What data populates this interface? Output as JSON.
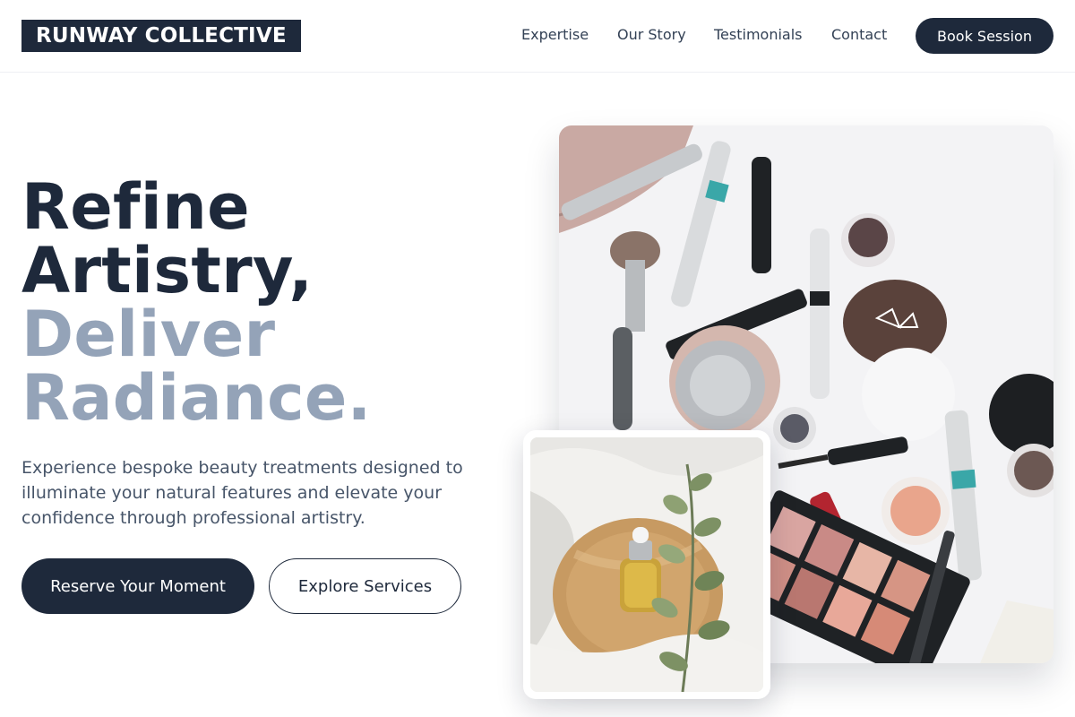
{
  "header": {
    "logo": "RUNWAY COLLECTIVE",
    "nav": [
      "Expertise",
      "Our Story",
      "Testimonials",
      "Contact"
    ],
    "cta": "Book Session"
  },
  "hero": {
    "headline_dark_1": "Refine",
    "headline_dark_2": "Artistry,",
    "headline_muted_1": "Deliver",
    "headline_muted_2": "Radiance.",
    "subtext": "Experience bespoke beauty treatments designed to illuminate your natural features and elevate your confidence through professional artistry.",
    "primary_button": "Reserve Your Moment",
    "secondary_button": "Explore Services"
  },
  "colors": {
    "primary": "#1e293b",
    "muted_heading": "#94a3b8",
    "body_text": "#475569"
  }
}
